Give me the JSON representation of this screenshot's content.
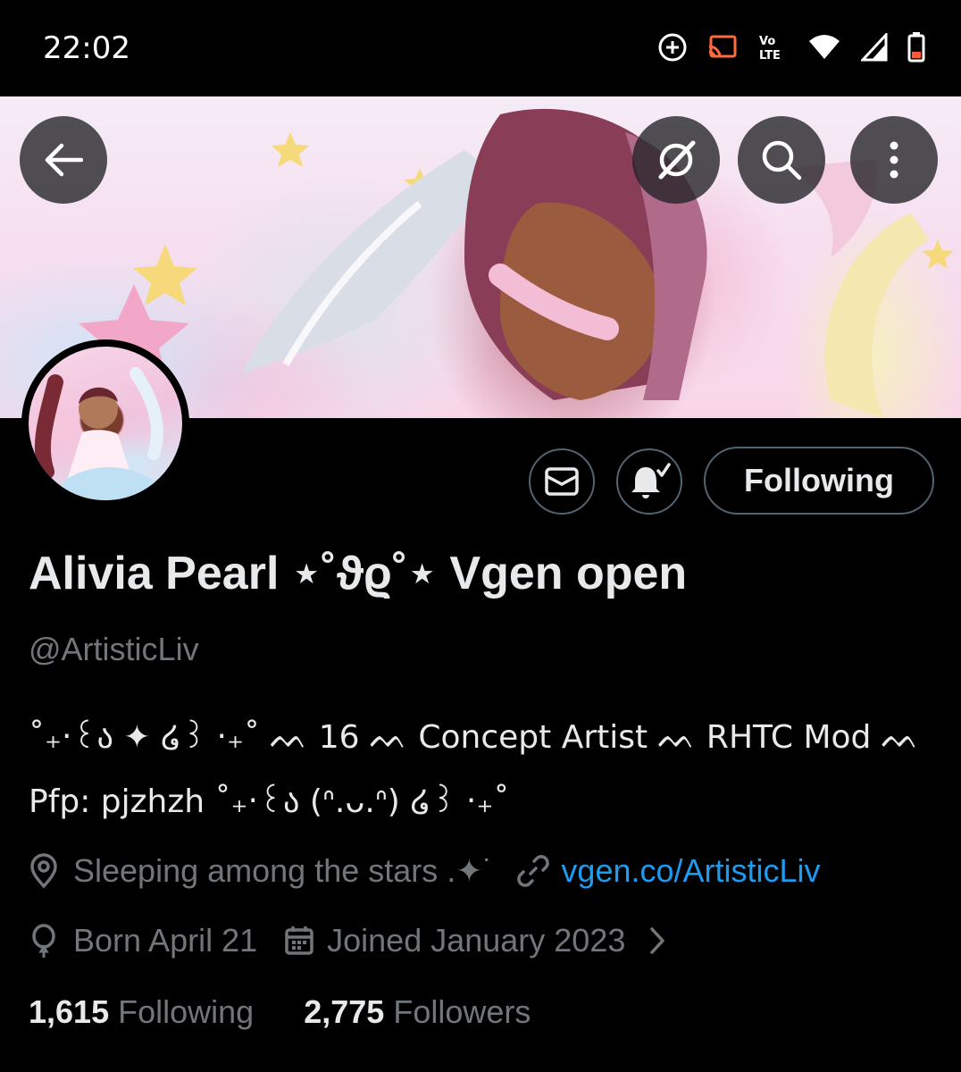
{
  "status_bar": {
    "time": "22:02"
  },
  "profile": {
    "display_name": "Alivia Pearl ⋆˚ϑϱ˚⋆ Vgen open",
    "handle": "@ArtisticLiv",
    "bio_line_1": "˚₊‧꒰ა ✦ ໒꒱ ‧₊˚  ᨓ 16   ᨓ Concept Artist   ᨓ RHTC Mod   ᨓ",
    "bio_line_2": "Pfp: pjzhzh  ˚₊‧꒰ა (ᐢ.ᴗ.ᐢ) ໒꒱ ‧₊˚",
    "location": "Sleeping among the stars .✦˙",
    "website": "vgen.co/ArtisticLiv",
    "birthday": "Born April 21",
    "joined": "Joined January 2023",
    "following_count": "1,615",
    "following_label": "Following",
    "followers_count": "2,775",
    "followers_label": "Followers"
  },
  "actions": {
    "follow_state_label": "Following"
  },
  "icons": [
    "back-arrow-icon",
    "grok-icon",
    "search-icon",
    "more-vertical-icon",
    "mail-icon",
    "bell-check-icon",
    "location-pin-icon",
    "link-icon",
    "balloon-icon",
    "calendar-icon",
    "chevron-right-icon"
  ],
  "colors": {
    "link": "#1d9bf0",
    "secondary_text": "#71767b",
    "border": "#536471"
  }
}
